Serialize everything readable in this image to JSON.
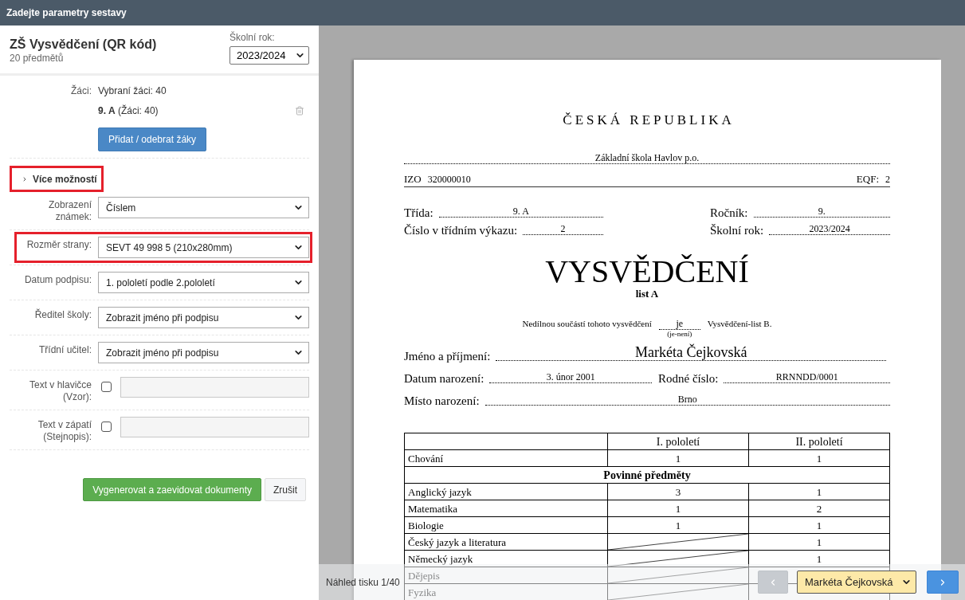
{
  "window": {
    "title": "Zadejte parametry sestavy"
  },
  "report": {
    "title": "ZŠ Vysvědčení (QR kód)",
    "subtitle": "20 předmětů",
    "school_year": {
      "label": "Školní rok:",
      "value": "2023/2024"
    }
  },
  "students": {
    "label": "Žáci:",
    "summary": "Vybraní žáci: 40",
    "groups": [
      {
        "name": "9. A",
        "count": "(Žáci: 40)"
      }
    ],
    "button": "Přidat / odebrat žáky"
  },
  "more_options": {
    "label": "Více možností",
    "highlighted": true
  },
  "options": [
    {
      "kind": "select",
      "label": "Zobrazení známek:",
      "value": "Číslem",
      "highlighted": false
    },
    {
      "kind": "select",
      "label": "Rozměr strany:",
      "value": "SEVT 49 998 5 (210x280mm)",
      "highlighted": true
    },
    {
      "kind": "select",
      "label": "Datum podpisu:",
      "value": "1. pololetí podle 2.pololetí",
      "highlighted": false
    },
    {
      "kind": "select",
      "label": "Ředitel školy:",
      "value": "Zobrazit jméno při podpisu",
      "highlighted": false
    },
    {
      "kind": "select",
      "label": "Třídní učitel:",
      "value": "Zobrazit jméno při podpisu",
      "highlighted": false
    },
    {
      "kind": "text",
      "label": "Text v hlavičce (Vzor):",
      "checked": false,
      "highlighted": false
    },
    {
      "kind": "text",
      "label": "Text v zápatí (Stejnopis):",
      "checked": false,
      "highlighted": false
    }
  ],
  "actions": [
    {
      "kind": "primary",
      "label": "Vygenerovat a zaevidovat dokumenty"
    },
    {
      "kind": "secondary",
      "label": "Zrušit"
    }
  ],
  "document": {
    "country": "ČESKÁ REPUBLIKA",
    "school": "Základní škola Havlov p.o.",
    "izo": {
      "label": "IZO",
      "value": "320000010"
    },
    "eqf": {
      "label": "EQF:",
      "value": "2"
    },
    "class_fields": [
      {
        "label": "Třída:",
        "value": "9. A"
      },
      {
        "label": "Ročník:",
        "value": "9."
      },
      {
        "label": "Číslo v třídním výkazu:",
        "value": "2"
      },
      {
        "label": "Školní rok:",
        "value": "2023/2024"
      }
    ],
    "title": "VYSVĚDČENÍ",
    "subtitle": "list A",
    "attachment": {
      "before": "Nedílnou součástí tohoto vysvědčení",
      "value": "je",
      "hint": "(je-není)",
      "after": "Vysvědčení-list B."
    },
    "name": {
      "label": "Jméno a příjmení:",
      "value": "Markéta Čejkovská"
    },
    "birth_fields": [
      {
        "label": "Datum narození:",
        "value": "3. únor 2001"
      },
      {
        "label": "Rodné číslo:",
        "value": "RRNNDD/0001"
      }
    ],
    "birthplace": {
      "label": "Místo narození:",
      "value": "Brno"
    },
    "table": {
      "columns": [
        "I. pololetí",
        "II. pololetí"
      ],
      "rows": [
        {
          "kind": "subject",
          "name": "Chování",
          "grades": [
            {
              "value": "1",
              "crossed": false
            },
            {
              "value": "1",
              "crossed": false
            }
          ]
        },
        {
          "kind": "section",
          "title": "Povinné předměty"
        },
        {
          "kind": "subject",
          "name": "Anglický jazyk",
          "grades": [
            {
              "value": "3",
              "crossed": false
            },
            {
              "value": "1",
              "crossed": false
            }
          ]
        },
        {
          "kind": "subject",
          "name": "Matematika",
          "grades": [
            {
              "value": "1",
              "crossed": false
            },
            {
              "value": "2",
              "crossed": false
            }
          ]
        },
        {
          "kind": "subject",
          "name": "Biologie",
          "grades": [
            {
              "value": "1",
              "crossed": false
            },
            {
              "value": "1",
              "crossed": false
            }
          ]
        },
        {
          "kind": "subject",
          "name": "Český jazyk a literatura",
          "grades": [
            {
              "crossed": true
            },
            {
              "value": "1",
              "crossed": false
            }
          ]
        },
        {
          "kind": "subject",
          "name": "Německý jazyk",
          "grades": [
            {
              "crossed": true
            },
            {
              "value": "1",
              "crossed": false
            }
          ]
        },
        {
          "kind": "subject",
          "name": "Dějepis",
          "grades": [
            {
              "crossed": true
            },
            {
              "crossed": false
            }
          ]
        },
        {
          "kind": "subject",
          "name": "Fyzika",
          "grades": [
            {
              "crossed": true
            },
            {
              "crossed": false
            }
          ]
        }
      ]
    }
  },
  "preview": {
    "label": "Náhled tisku 1/40",
    "student": "Markéta Čejkovská",
    "nav_buttons": [
      {
        "kind": "prev",
        "disabled": true
      },
      {
        "kind": "next",
        "disabled": false
      }
    ]
  }
}
